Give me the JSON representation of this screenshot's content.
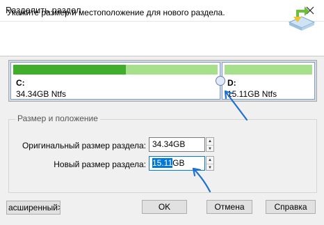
{
  "window": {
    "title": "Разделить раздел"
  },
  "header": {
    "text": "Укажите размер и местоположение для нового раздела."
  },
  "disk_map": {
    "partitions": [
      {
        "label": "C:",
        "size_text": "34.34GB Ntfs",
        "used_fraction": 0.55
      },
      {
        "label": "D:",
        "size_text": "15.11GB Ntfs",
        "used_fraction": 0.0
      }
    ]
  },
  "size_group": {
    "title": "Размер и положение",
    "original_label": "Оригинальный размер раздела:",
    "original_value": "34.34GB",
    "new_label": "Новый размер раздела:",
    "new_value_selected": "15.11",
    "new_value_unit": "GB"
  },
  "buttons": {
    "advanced": "асширенный>>",
    "ok": "OK",
    "cancel": "Отмена",
    "help": "Справка"
  },
  "colors": {
    "accent": "#0078d7",
    "bar_used": "#3fae2a",
    "bar_free": "#a6e08a",
    "arrow": "#1e6fd0"
  }
}
